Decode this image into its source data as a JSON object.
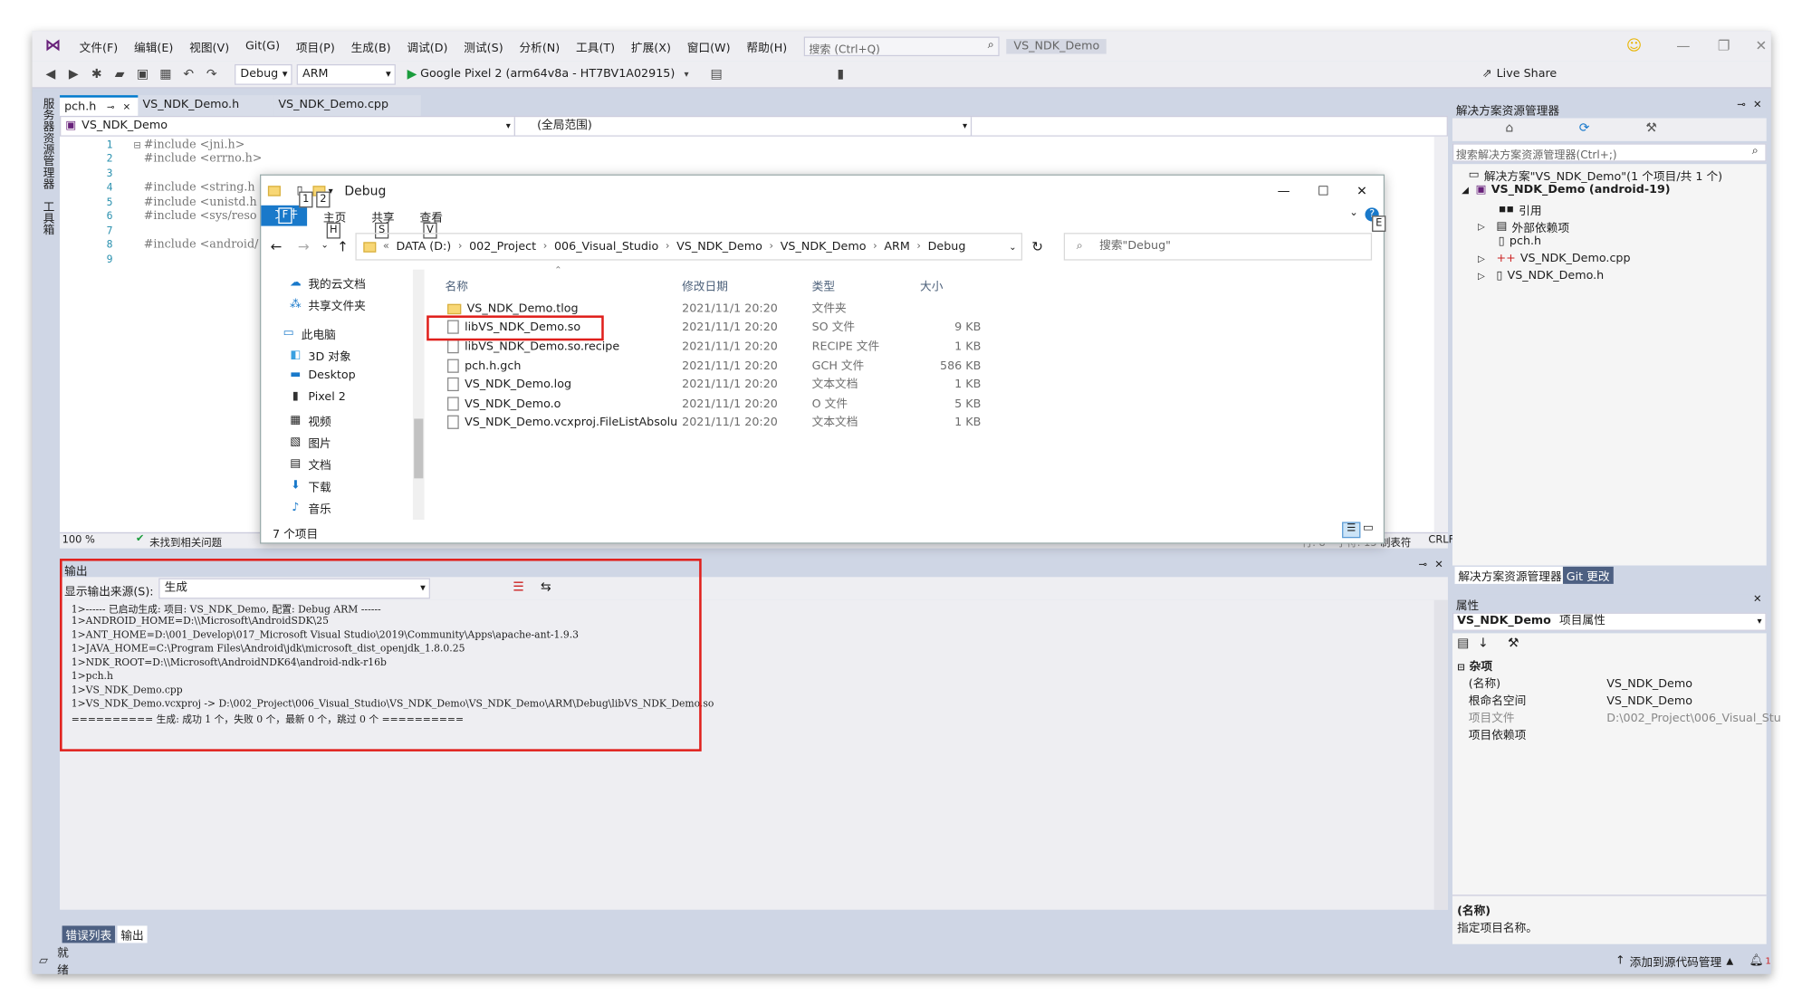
{
  "menubar": {
    "items": [
      "文件(F)",
      "编辑(E)",
      "视图(V)",
      "Git(G)",
      "项目(P)",
      "生成(B)",
      "调试(D)",
      "测试(S)",
      "分析(N)",
      "工具(T)",
      "扩展(X)",
      "窗口(W)",
      "帮助(H)"
    ],
    "search_placeholder": "搜索 (Ctrl+Q)",
    "solution_name": "VS_NDK_Demo"
  },
  "toolbar": {
    "config": "Debug",
    "platform": "ARM",
    "run_target": "Google Pixel 2 (arm64v8a - HT7BV1A02915)",
    "live_share": "Live Share"
  },
  "side_strip": {
    "items": [
      "服务器资源管理器",
      "工具箱"
    ]
  },
  "doc_tabs": [
    "pch.h",
    "VS_NDK_Demo.h",
    "VS_NDK_Demo.cpp"
  ],
  "nav_bar": {
    "project": "VS_NDK_Demo",
    "scope": "(全局范围)"
  },
  "code": {
    "line_numbers": [
      "1",
      "2",
      "3",
      "4",
      "5",
      "6",
      "7",
      "8",
      "9"
    ],
    "lines": [
      "#include <jni.h>",
      "#include <errno.h>",
      "",
      "#include <string.h",
      "#include <unistd.h",
      "#include <sys/reso",
      "",
      "#include <android/",
      ""
    ]
  },
  "editor_status": {
    "zoom": "100 %",
    "issues": "未找到相关问题",
    "line": "行: 8",
    "char": "字符: 15",
    "tabs": "制表符",
    "eol": "CRLF"
  },
  "output": {
    "title": "输出",
    "source_label": "显示输出来源(S):",
    "source_value": "生成",
    "lines": [
      "1>------ 已启动生成: 项目: VS_NDK_Demo, 配置: Debug ARM ------",
      "1>ANDROID_HOME=D:\\\\Microsoft\\AndroidSDK\\25",
      "1>ANT_HOME=D:\\001_Develop\\017_Microsoft Visual Studio\\2019\\Community\\Apps\\apache-ant-1.9.3",
      "1>JAVA_HOME=C:\\Program Files\\Android\\jdk\\microsoft_dist_openjdk_1.8.0.25",
      "1>NDK_ROOT=D:\\\\Microsoft\\AndroidNDK64\\android-ndk-r16b",
      "1>pch.h",
      "1>VS_NDK_Demo.cpp",
      "1>VS_NDK_Demo.vcxproj -> D:\\002_Project\\006_Visual_Studio\\VS_NDK_Demo\\VS_NDK_Demo\\ARM\\Debug\\libVS_NDK_Demo.so",
      "========== 生成: 成功 1 个，失败 0 个，最新 0 个，跳过 0 个 =========="
    ],
    "bottom_tabs": [
      "错误列表",
      "输出"
    ]
  },
  "solution_explorer": {
    "title": "解决方案资源管理器",
    "search_placeholder": "搜索解决方案资源管理器(Ctrl+;)",
    "items": [
      {
        "label": "解决方案\"VS_NDK_Demo\"(1 个项目/共 1 个)"
      },
      {
        "label": "VS_NDK_Demo (android-19)"
      },
      {
        "label": "引用"
      },
      {
        "label": "外部依赖项"
      },
      {
        "label": "pch.h"
      },
      {
        "label": "VS_NDK_Demo.cpp"
      },
      {
        "label": "VS_NDK_Demo.h"
      }
    ],
    "tabs": [
      "解决方案资源管理器",
      "Git 更改"
    ]
  },
  "properties": {
    "title": "属性",
    "object": "VS_NDK_Demo",
    "object_type": "项目属性",
    "category": "杂项",
    "rows": [
      {
        "name": "(名称)",
        "value": "VS_NDK_Demo"
      },
      {
        "name": "根命名空间",
        "value": "VS_NDK_Demo"
      },
      {
        "name": "项目文件",
        "value": "D:\\002_Project\\006_Visual_Stu"
      },
      {
        "name": "项目依赖项",
        "value": ""
      }
    ],
    "desc_title": "(名称)",
    "desc_text": "指定项目名称。"
  },
  "statusbar": {
    "ready": "就绪",
    "source_control": "添加到源代码管理",
    "notifications": "1"
  },
  "explorer": {
    "title": "Debug",
    "ribbon_tabs": [
      "文件",
      "主页",
      "共享",
      "查看"
    ],
    "key_tips": [
      "1",
      "2",
      "F",
      "H",
      "S",
      "V",
      "E"
    ],
    "breadcrumbs": [
      "DATA (D:)",
      "002_Project",
      "006_Visual_Studio",
      "VS_NDK_Demo",
      "VS_NDK_Demo",
      "ARM",
      "Debug"
    ],
    "search_placeholder": "搜索\"Debug\"",
    "nav_items": [
      "我的云文档",
      "共享文件夹",
      "此电脑",
      "3D 对象",
      "Desktop",
      "Pixel 2",
      "视频",
      "图片",
      "文档",
      "下载",
      "音乐"
    ],
    "columns": [
      "名称",
      "修改日期",
      "类型",
      "大小"
    ],
    "files": [
      {
        "name": "VS_NDK_Demo.tlog",
        "date": "2021/11/1 20:20",
        "type": "文件夹",
        "size": ""
      },
      {
        "name": "libVS_NDK_Demo.so",
        "date": "2021/11/1 20:20",
        "type": "SO 文件",
        "size": "9 KB"
      },
      {
        "name": "libVS_NDK_Demo.so.recipe",
        "date": "2021/11/1 20:20",
        "type": "RECIPE 文件",
        "size": "1 KB"
      },
      {
        "name": "pch.h.gch",
        "date": "2021/11/1 20:20",
        "type": "GCH 文件",
        "size": "586 KB"
      },
      {
        "name": "VS_NDK_Demo.log",
        "date": "2021/11/1 20:20",
        "type": "文本文档",
        "size": "1 KB"
      },
      {
        "name": "VS_NDK_Demo.o",
        "date": "2021/11/1 20:20",
        "type": "O 文件",
        "size": "5 KB"
      },
      {
        "name": "VS_NDK_Demo.vcxproj.FileListAbsolut...",
        "date": "2021/11/1 20:20",
        "type": "文本文档",
        "size": "1 KB"
      }
    ],
    "item_count": "7 个项目"
  },
  "colors": {
    "vs_frame": "#cfd6e5",
    "menubar": "#eeeef2",
    "highlight_box": "#e0201c",
    "accent": "#007acc"
  }
}
